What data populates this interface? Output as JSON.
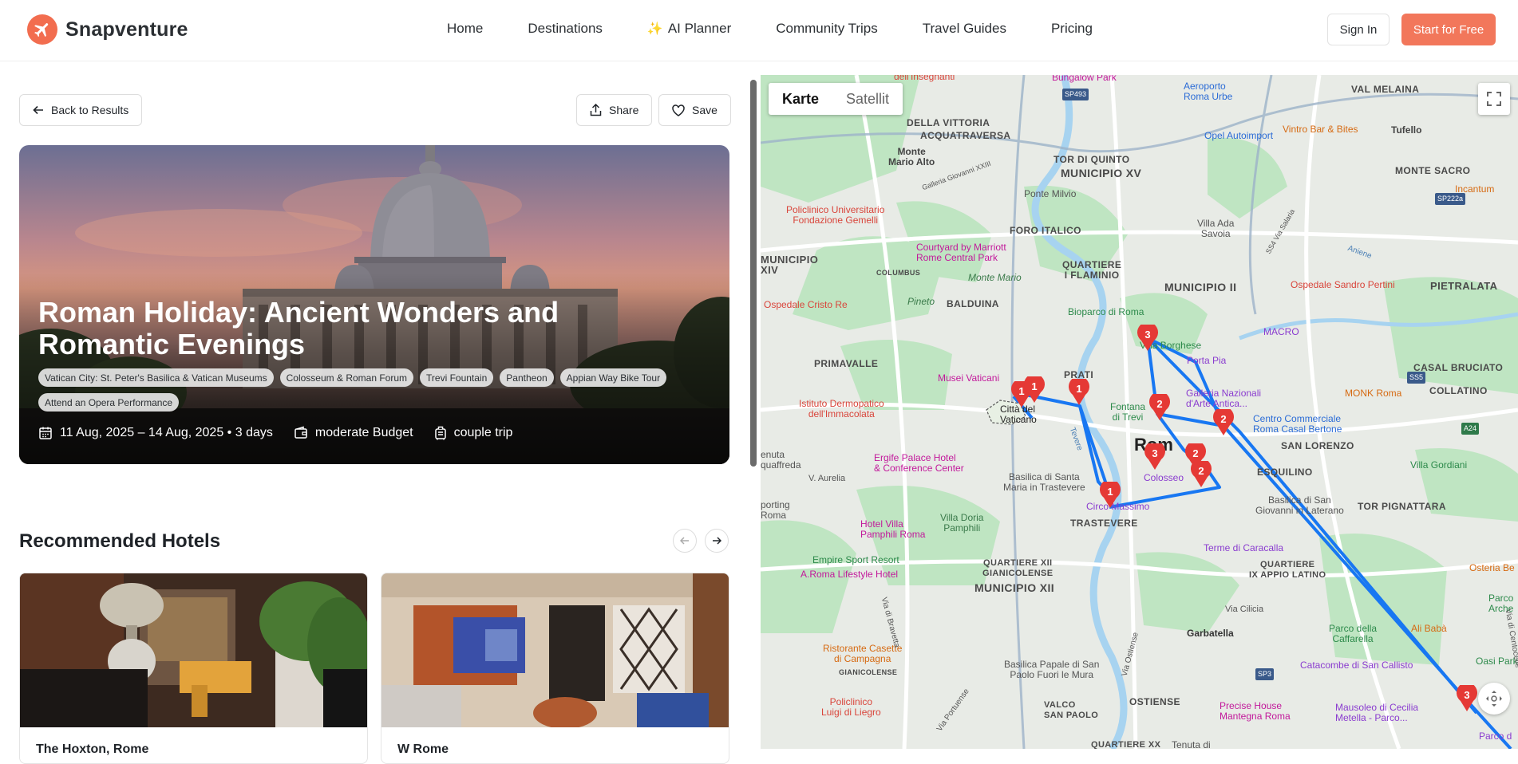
{
  "header": {
    "logo_text": "Snapventure",
    "nav": [
      "Home",
      "Destinations",
      "AI Planner",
      "Community Trips",
      "Travel Guides",
      "Pricing"
    ],
    "sign_in": "Sign In",
    "start_free": "Start for Free",
    "accent": "#f2775b"
  },
  "toolbar": {
    "back": "Back to Results",
    "share": "Share",
    "save": "Save"
  },
  "hero": {
    "title": "Roman Holiday: Ancient Wonders and Romantic Evenings",
    "tags": [
      "Vatican City: St. Peter's Basilica & Vatican Museums",
      "Colosseum & Roman Forum",
      "Trevi Fountain",
      "Pantheon",
      "Appian Way Bike Tour",
      "Attend an Opera Performance"
    ],
    "dates": "11 Aug, 2025 – 14 Aug, 2025 • 3 days",
    "budget": "moderate Budget",
    "trip_type": "couple trip"
  },
  "hotels": {
    "title": "Recommended Hotels",
    "items": [
      {
        "name": "The Hoxton, Rome"
      },
      {
        "name": "W Rome"
      }
    ]
  },
  "map": {
    "mode_map": "Karte",
    "mode_satellite": "Satellit",
    "city": "Rom",
    "labels": {
      "monte_mario_alto": "Monte\nMario Alto",
      "villa_vittoria": "DELLA VITTORIA",
      "acquatraversa": "ACQUATRAVERSA",
      "tor_di_quinto": "TOR DI QUINTO",
      "municipio_xv": "MUNICIPIO XV",
      "ponte_milvio": "Ponte Milvio",
      "foro_italico": "FORO ITALICO",
      "villa_ada": "Villa Ada\nSavoia",
      "aeroporto": "Aeroporto\nRoma Urbe",
      "opel": "Opel Autoimport",
      "val_melaina": "VAL MELAINA",
      "vintro": "Vintro Bar & Bites",
      "tufello": "Tufello",
      "monte_sacro": "MONTE SACRO",
      "incantum": "Incantum",
      "policlinico_gemelli": "Policlinico Universitario\nFondazione Gemelli",
      "courtyard": "Courtyard by Marriott\nRome Central Park",
      "municipio_xiv": "MUNICIPIO\nXIV",
      "quartiere_flaminio": "QUARTIERE\nI FLAMINIO",
      "monte_mario": "Monte Mario",
      "municipio_ii": "MUNICIPIO II",
      "pietralata": "PIETRALATA",
      "ospedale_pertini": "Ospedale Sandro Pertini",
      "ospedale_cristo_re": "Ospedale Cristo Re",
      "pineto": "Pineto",
      "balduina": "BALDUINA",
      "bioparco": "Bioparco di Roma",
      "macro": "MACRO",
      "primavalle": "PRIMAVALLE",
      "villa_borghese": "Villa Borghese",
      "porta_pia": "Porta Pia",
      "casal_bruciato": "CASAL BRUCIATO",
      "musei_vaticani": "Musei Vaticani",
      "prati": "PRATI",
      "galleria": "Galleria Nazionali\nd'Arte Antica...",
      "monk": "MONK Roma",
      "collatino": "COLLATINO",
      "istituto": "Istituto Dermopatico\ndell'Immacolata",
      "citta_vaticano": "Città del\nVaticano",
      "fontana_trevi": "Fontana\ndi Trevi",
      "centro_commerciale": "Centro Commerciale\nRoma Casal Bertone",
      "san_lorenzo": "SAN LORENZO",
      "ergife": "Ergife Palace Hotel\n& Conference Center",
      "aurelia": "V. Aurelia",
      "basilica_trastevere": "Basilica di Santa\nMaria in Trastevere",
      "colosseo": "Colosseo",
      "esquilino": "ESQUILINO",
      "villa_gordiani": "Villa Gordiani",
      "circo_massimo": "Circo Massimo",
      "basilica_laterano": "Basilica di San\nGiovanni in Laterano",
      "tor_pignattara": "TOR PIGNATTARA",
      "trastevere": "TRASTEVERE",
      "hotel_villa_pamphili": "Hotel Villa\nPamphili Roma",
      "villa_doria": "Villa Doria\nPamphili",
      "terme_caracalla": "Terme di Caracalla",
      "empire_sport": "Empire Sport Resort",
      "aroma": "A.Roma Lifestyle Hotel",
      "quartiere_xii": "QUARTIERE XII\nGIANICOLENSE",
      "municipio_xii": "MUNICIPIO XII",
      "quartiere_latino": "QUARTIERE\nIX APPIO LATINO",
      "osteria": "Osteria Be",
      "via_cilicia": "Via Cilicia",
      "ali_baba": "Ali Babà",
      "porco_caffarella": "Parco della\nCaffarella",
      "garbatella": "Garbatella",
      "ristorante": "Ristorante Casette\ndi Campagna",
      "gianicolense": "GIANICOLENSE",
      "basilica_paolo": "Basilica Papale di San\nPaolo Fuori le Mura",
      "catacombe": "Catacombe di San Callisto",
      "policlinico_liegro": "Policlinico\nLuigi di Liegro",
      "valco": "VALCO\nSAN PAOLO",
      "ostiense": "OSTIENSE",
      "precise_house": "Precise House\nMantegna Roma",
      "mausoleo": "Mausoleo di Cecilia\nMetella - Parco...",
      "quartiere_xx": "QUARTIERE XX",
      "oasi_park": "Oasi Park",
      "tenuta": "Tenuta di",
      "porting_roma": "porting\nRoma",
      "aquedotti": "Parco\nArche",
      "via_aurelia_antica": "enuta\nquaffreda",
      "centocelle": "Via di Centocelle",
      "via_bravetta": "Via di Bravetta",
      "via_portuense": "Via Portuense",
      "via_ostiense": "Via Ostiense",
      "sp493": "SP493",
      "sp222a": "SP222a",
      "ss5": "SS5",
      "a24": "A24",
      "sp3": "SP3",
      "bungalow": "Bungalow Park",
      "tevere": "Tevere",
      "aniene": "Aniene",
      "via_salaria": "SS4 Via Salaria",
      "galleria_giovanni": "Galleria Giovanni XXIII",
      "columbus": "COLUMBUS",
      "dell_insegnanti": "dell'Insegnanti",
      "parco_d": "Parco d"
    },
    "markers": [
      {
        "label": "1"
      },
      {
        "label": "1"
      },
      {
        "label": "1"
      },
      {
        "label": "1"
      },
      {
        "label": "2"
      },
      {
        "label": "2"
      },
      {
        "label": "2"
      },
      {
        "label": "2"
      },
      {
        "label": "3"
      },
      {
        "label": "3"
      },
      {
        "label": "3"
      }
    ]
  }
}
